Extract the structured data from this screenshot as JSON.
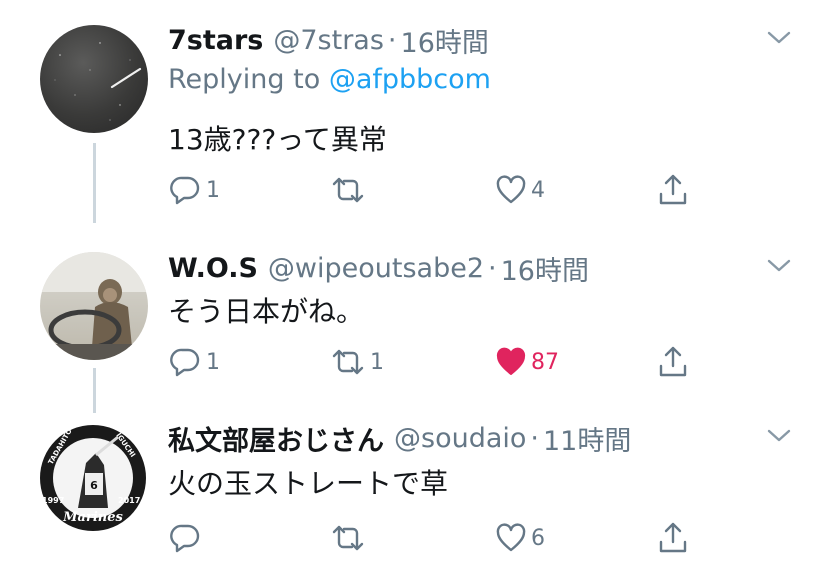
{
  "tweets": [
    {
      "display_name": "7stars",
      "handle": "@7stras",
      "separator": "·",
      "time": "16時間",
      "replying_prefix": "Replying to",
      "replying_to": "@afpbbcom",
      "text": "13歳???って異常",
      "reply_count": "1",
      "retweet_count": "",
      "like_count": "4",
      "liked": false,
      "avatar_icon": "night-sky-meteor-avatar"
    },
    {
      "display_name": "W.O.S",
      "handle": "@wipeoutsabe2",
      "separator": "·",
      "time": "16時間",
      "text": "そう日本がね。",
      "reply_count": "1",
      "retweet_count": "1",
      "like_count": "87",
      "liked": true,
      "avatar_icon": "monkey-driving-avatar"
    },
    {
      "display_name": "私文部屋おじさん",
      "handle": "@soudaio",
      "separator": "·",
      "time": "11時間",
      "text": "火の玉ストレートで草",
      "reply_count": "",
      "retweet_count": "",
      "like_count": "6",
      "liked": false,
      "avatar_icon": "marines-badge-avatar",
      "badge": {
        "top_left": "TADAHITO",
        "top_right": "IGUCHI",
        "number": "6",
        "year_left": "1997",
        "year_right": "2017",
        "team": "Marines"
      }
    }
  ],
  "colors": {
    "like_active": "#e0245e",
    "link": "#1da1f2",
    "secondary": "#657786"
  }
}
